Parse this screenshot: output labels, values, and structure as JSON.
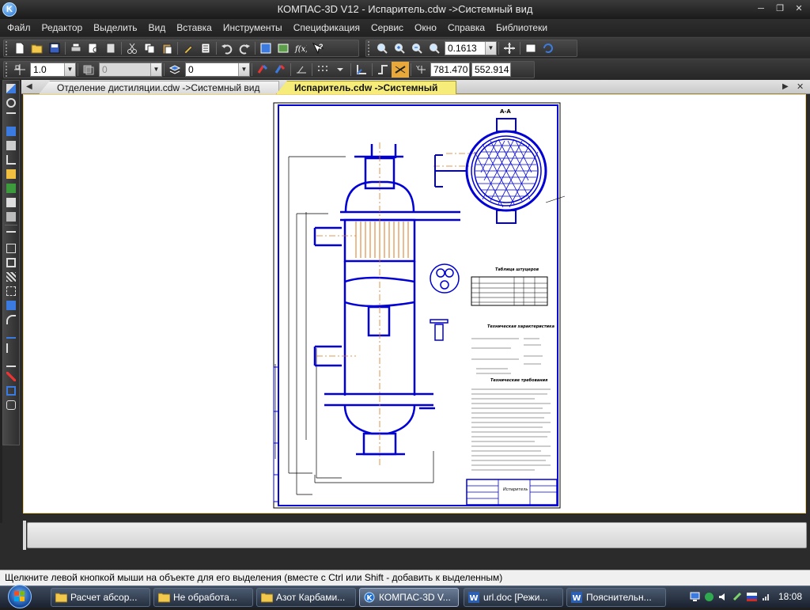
{
  "window": {
    "title": "КОМПАС-3D V12 - Испаритель.cdw ->Системный вид",
    "app_icon_letter": "K"
  },
  "menu": [
    "Файл",
    "Редактор",
    "Выделить",
    "Вид",
    "Вставка",
    "Инструменты",
    "Спецификация",
    "Сервис",
    "Окно",
    "Справка",
    "Библиотеки"
  ],
  "toolbar1": {
    "zoom_value": "0.1613"
  },
  "toolbar2": {
    "step_value": "1.0",
    "layer_value": "0",
    "style_value": "0",
    "coord_x": "781.470",
    "coord_y": "552.914"
  },
  "tabs": [
    {
      "label": "Отделение дистиляции.cdw ->Системный вид",
      "active": false
    },
    {
      "label": "Испаритель.cdw ->Системный вид",
      "active": true
    }
  ],
  "drawing": {
    "section_label": "А-А",
    "table_title": "Таблица штуцеров",
    "tech_title": "Техническая характеристика",
    "req_title": "Технические требования",
    "stamp_name": "Испаритель"
  },
  "status_text": "Щелкните левой кнопкой мыши на объекте для его выделения (вместе с Ctrl или Shift - добавить к выделенным)",
  "taskbar": {
    "items": [
      {
        "label": "Расчет абсор...",
        "icon": "folder-icon",
        "active": false
      },
      {
        "label": "Не обработа...",
        "icon": "folder-icon",
        "active": false
      },
      {
        "label": "Азот Карбами...",
        "icon": "folder-icon",
        "active": false
      },
      {
        "label": "КОМПАС-3D V...",
        "icon": "kompas-icon",
        "active": true
      },
      {
        "label": "url.doc [Режи...",
        "icon": "word-icon",
        "active": false
      },
      {
        "label": "Пояснительн...",
        "icon": "word-icon",
        "active": false
      }
    ],
    "clock": "18:08"
  },
  "colors": {
    "accent_tab": "#f6ec7a",
    "drawing_blue": "#0000d6",
    "drawing_orange": "#d97a1c"
  }
}
